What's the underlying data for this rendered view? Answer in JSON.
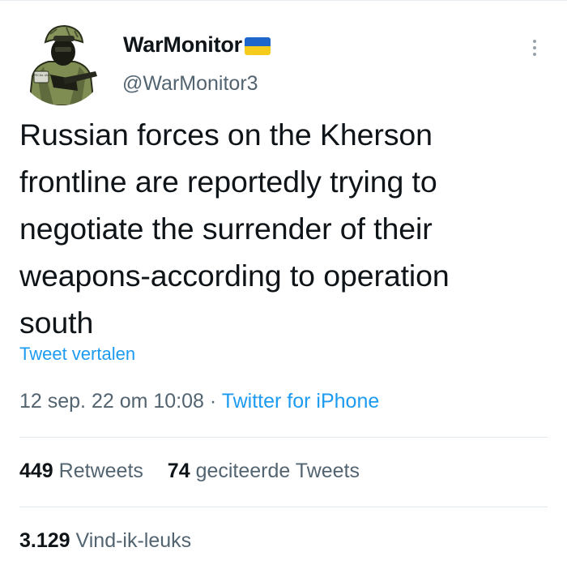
{
  "user": {
    "display_name": "WarMonitor",
    "handle": "@WarMonitor3",
    "avatar_patch_text": "SPECIAL\nUNIT",
    "flag_colors": {
      "top": "#1e66c9",
      "bottom": "#f5cc1b"
    }
  },
  "tweet": {
    "text": "Russian forces on the Kherson\nfrontline are reportedly trying to\nnegotiate the surrender of their\nweapons-according to operation\nsouth",
    "translate_label": "Tweet vertalen",
    "timestamp": "12 sep. 22 om 10:08",
    "separator": "·",
    "source": "Twitter for iPhone"
  },
  "stats": {
    "retweets_count": "449",
    "retweets_label": "Retweets",
    "quotes_count": "74",
    "quotes_label": "geciteerde Tweets",
    "likes_count": "3.129",
    "likes_label": "Vind-ik-leuks"
  },
  "icons": {
    "more": "more-vertical-icon",
    "verified_flag": "ukraine-flag-icon"
  },
  "colors": {
    "text": "#0f1419",
    "secondary": "#536471",
    "link": "#1d9bf0",
    "divider": "#e1e8ed"
  }
}
